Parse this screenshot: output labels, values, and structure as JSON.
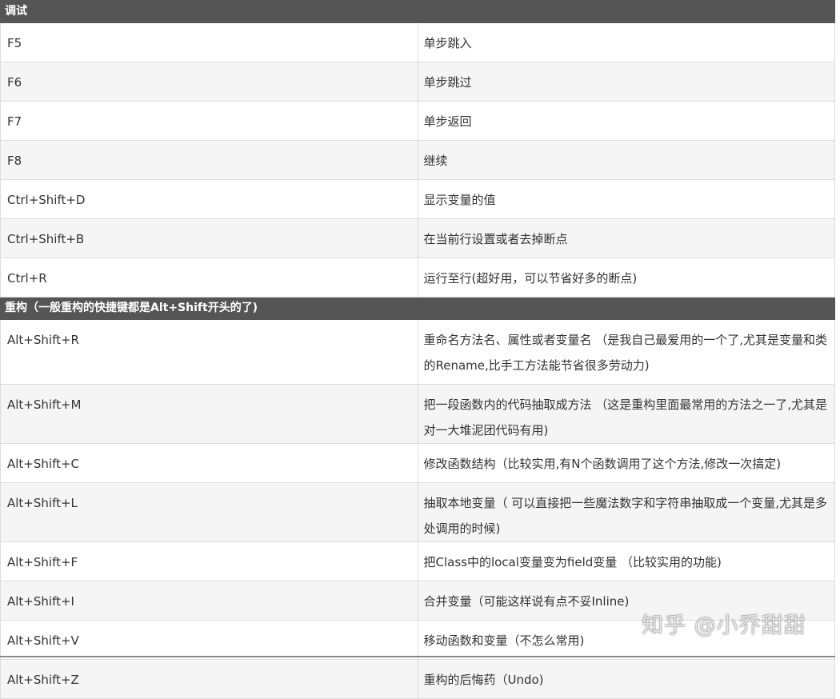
{
  "sections": [
    {
      "title": "调试",
      "rows": [
        {
          "key": "F5",
          "desc": "单步跳入"
        },
        {
          "key": "F6",
          "desc": "单步跳过"
        },
        {
          "key": "F7",
          "desc": "单步返回"
        },
        {
          "key": "F8",
          "desc": "继续"
        },
        {
          "key": "Ctrl+Shift+D",
          "desc": "显示变量的值"
        },
        {
          "key": "Ctrl+Shift+B",
          "desc": "在当前行设置或者去掉断点"
        },
        {
          "key": "Ctrl+R",
          "desc": "运行至行(超好用，可以节省好多的断点)"
        }
      ]
    },
    {
      "title": "重构（一般重构的快捷键都是Alt+Shift开头的了)",
      "rows": [
        {
          "key": "Alt+Shift+R",
          "desc": "重命名方法名、属性或者变量名 （是我自己最爱用的一个了,尤其是变量和类的Rename,比手工方法能节省很多劳动力)"
        },
        {
          "key": "Alt+Shift+M",
          "desc": "把一段函数内的代码抽取成方法 （这是重构里面最常用的方法之一了,尤其是对一大堆泥团代码有用)"
        },
        {
          "key": "Alt+Shift+C",
          "desc": "修改函数结构（比较实用,有N个函数调用了这个方法,修改一次搞定)"
        },
        {
          "key": "Alt+Shift+L",
          "desc": "抽取本地变量（ 可以直接把一些魔法数字和字符串抽取成一个变量,尤其是多处调用的时候)"
        },
        {
          "key": "Alt+Shift+F",
          "desc": "把Class中的local变量变为field变量 （比较实用的功能)"
        },
        {
          "key": "Alt+Shift+I",
          "desc": "合并变量（可能这样说有点不妥Inline)"
        },
        {
          "key": "Alt+Shift+V",
          "desc": "移动函数和变量（不怎么常用)"
        },
        {
          "key": "Alt+Shift+Z",
          "desc": "重构的后悔药（Undo)"
        }
      ]
    }
  ],
  "watermark": "知乎 @小乔甜甜"
}
